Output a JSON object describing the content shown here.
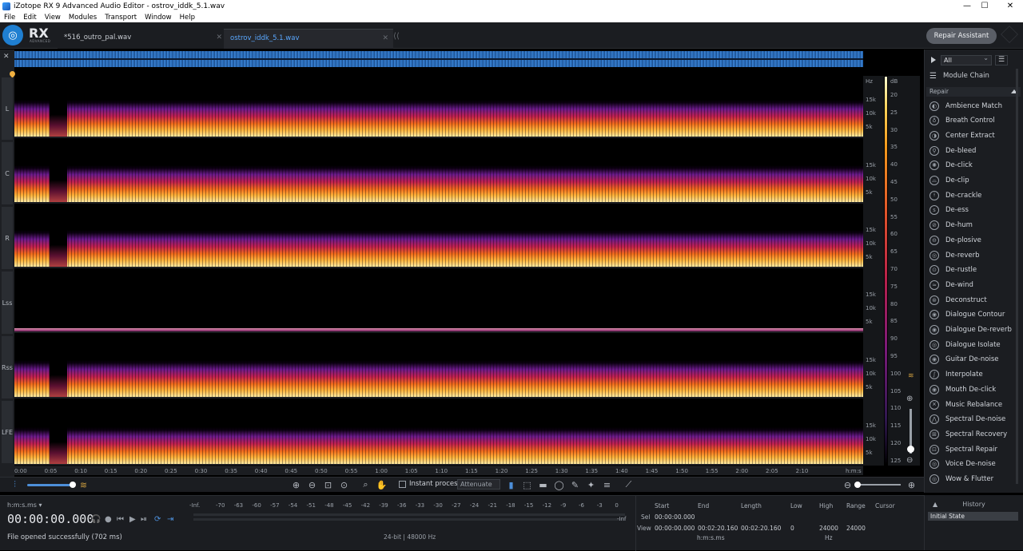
{
  "window": {
    "title": "iZotope RX 9 Advanced Audio Editor - ostrov_iddk_5.1.wav"
  },
  "menu": [
    "File",
    "Edit",
    "View",
    "Modules",
    "Transport",
    "Window",
    "Help"
  ],
  "brand": {
    "name": "RX",
    "sub": "ADVANCED"
  },
  "tabs": [
    {
      "label": "*516_outro_pal.wav"
    },
    {
      "label": "ostrov_iddk_5.1.wav"
    }
  ],
  "repair_assistant": "Repair Assistant",
  "channels": [
    "L",
    "C",
    "R",
    "Lss",
    "Rss",
    "LFE"
  ],
  "hz_unit": "Hz",
  "hz_ticks": [
    "15k",
    "10k",
    "5k"
  ],
  "db_unit": "dB",
  "db_ticks": [
    "20",
    "25",
    "30",
    "35",
    "40",
    "45",
    "50",
    "55",
    "60",
    "65",
    "70",
    "75",
    "80",
    "85",
    "90",
    "95",
    "100",
    "105",
    "110",
    "115",
    "120",
    "125"
  ],
  "timeline": [
    "0:00",
    "0:05",
    "0:10",
    "0:15",
    "0:20",
    "0:25",
    "0:30",
    "0:35",
    "0:40",
    "0:45",
    "0:50",
    "0:55",
    "1:00",
    "1:05",
    "1:10",
    "1:15",
    "1:20",
    "1:25",
    "1:30",
    "1:35",
    "1:40",
    "1:45",
    "1:50",
    "1:55",
    "2:00",
    "2:05",
    "2:10",
    "h:m:s"
  ],
  "panel": {
    "filter": "All",
    "module_chain": "Module Chain",
    "section": "Repair",
    "modules": [
      "Ambience Match",
      "Breath Control",
      "Center Extract",
      "De-bleed",
      "De-click",
      "De-clip",
      "De-crackle",
      "De-ess",
      "De-hum",
      "De-plosive",
      "De-reverb",
      "De-rustle",
      "De-wind",
      "Deconstruct",
      "Dialogue Contour",
      "Dialogue De-reverb",
      "Dialogue Isolate",
      "Guitar De-noise",
      "Interpolate",
      "Mouth De-click",
      "Music Rebalance",
      "Spectral De-noise",
      "Spectral Recovery",
      "Spectral Repair",
      "Voice De-noise",
      "Wow & Flutter"
    ]
  },
  "toolbar": {
    "instant_process": "Instant process",
    "attenuate": "Attenuate"
  },
  "status": {
    "time_format": "h:m:s.ms",
    "timecode": "00:00:00.000",
    "message": "File opened successfully (702 ms)",
    "format": "24-bit | 48000 Hz",
    "meter_ticks": [
      "-Inf.",
      "-70",
      "-63",
      "-60",
      "-57",
      "-54",
      "-51",
      "-48",
      "-45",
      "-42",
      "-39",
      "-36",
      "-33",
      "-30",
      "-27",
      "-24",
      "-21",
      "-18",
      "-15",
      "-12",
      "-9",
      "-6",
      "-3",
      "0"
    ],
    "meter_end": "-Inf"
  },
  "selection": {
    "start_h": "Start",
    "end_h": "End",
    "length_h": "Length",
    "sel_label": "Sel",
    "view_label": "View",
    "sel_start": "00:00:00.000",
    "view_start": "00:00:00.000",
    "view_end": "00:02:20.160",
    "view_length": "00:02:20.160",
    "unit": "h:m:s.ms"
  },
  "frequency": {
    "low_h": "Low",
    "high_h": "High",
    "range_h": "Range",
    "cursor_h": "Cursor",
    "low": "0",
    "high": "24000",
    "range": "24000",
    "unit": "Hz"
  },
  "history": {
    "title": "History",
    "items": [
      "Initial State"
    ]
  }
}
